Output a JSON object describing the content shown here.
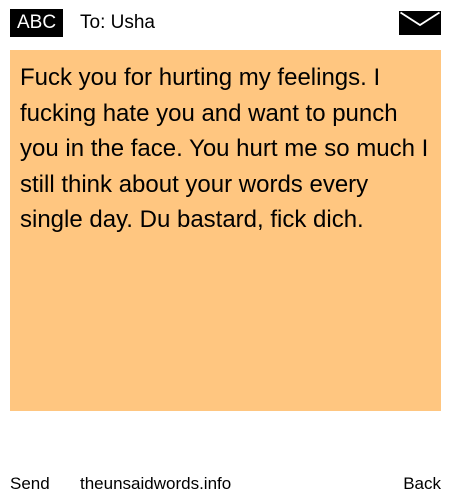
{
  "header": {
    "input_mode": "ABC",
    "recipient": "To: Usha",
    "envelope_icon": "envelope-icon"
  },
  "message": {
    "text": "Fuck you for hurting my feelings. I fucking hate you and want to punch you in the face. You hurt me so much I still think about your words every single day. Du bastard, fick dich.",
    "background": "#ffc680"
  },
  "footer": {
    "send_label": "Send",
    "site": "theunsaidwords.info",
    "back_label": "Back"
  }
}
